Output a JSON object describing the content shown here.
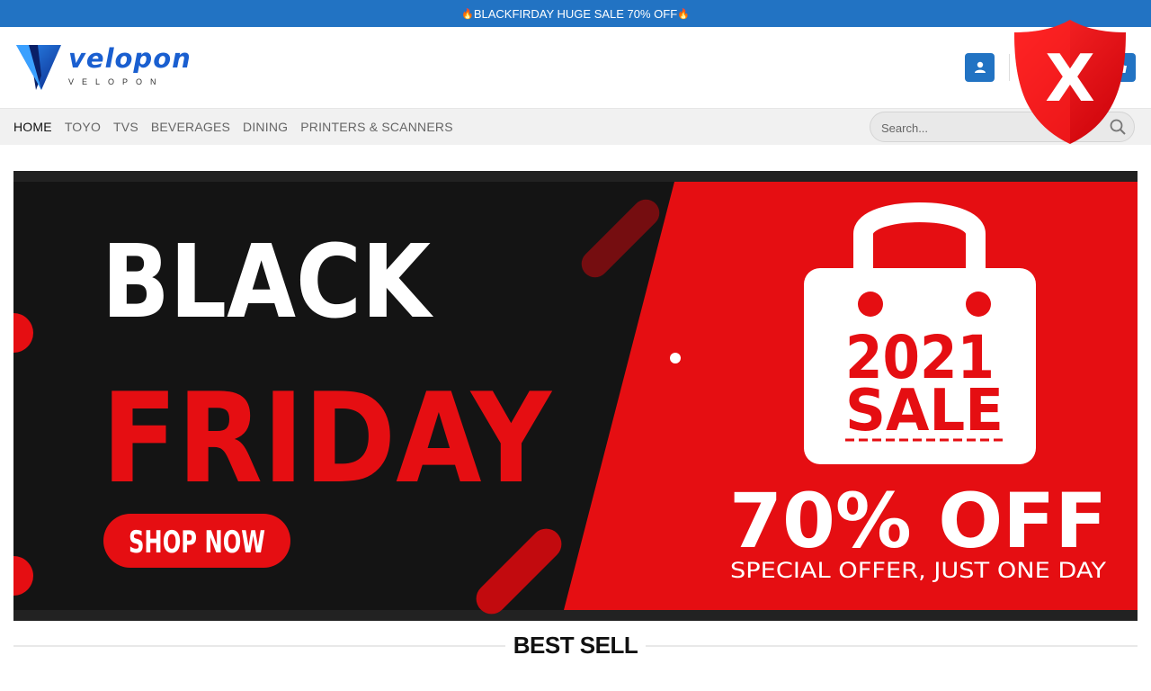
{
  "announcement": {
    "text": "BLACKFIRDAY HUGE SALE 70% OFF",
    "icon": "fire-icon"
  },
  "logo": {
    "word": "velopon",
    "sub": "VELOPON"
  },
  "header": {
    "account_icon": "user-icon",
    "cart_icon": "basket-icon"
  },
  "overlay": {
    "shield_letter": "X",
    "shield_color": "#e8141b"
  },
  "nav": {
    "items": [
      {
        "label": "HOME",
        "active": true
      },
      {
        "label": "TOYO"
      },
      {
        "label": "TVS"
      },
      {
        "label": "BEVERAGES"
      },
      {
        "label": "DINING"
      },
      {
        "label": "PRINTERS & SCANNERS"
      }
    ]
  },
  "search": {
    "placeholder": "Search..."
  },
  "banner": {
    "line1": "BLACK",
    "line2": "FRIDAY",
    "cta": "SHOP NOW",
    "bag_line1": "2021",
    "bag_line2": "SALE",
    "discount": "70% OFF",
    "tagline": "SPECIAL OFFER, JUST ONE DAY",
    "colors": {
      "red": "#e50e12",
      "dark": "#141414"
    }
  },
  "section": {
    "title": "BEST SELL"
  },
  "colors": {
    "brand_blue": "#2273c3",
    "logo_blue": "#1a5fd0"
  }
}
